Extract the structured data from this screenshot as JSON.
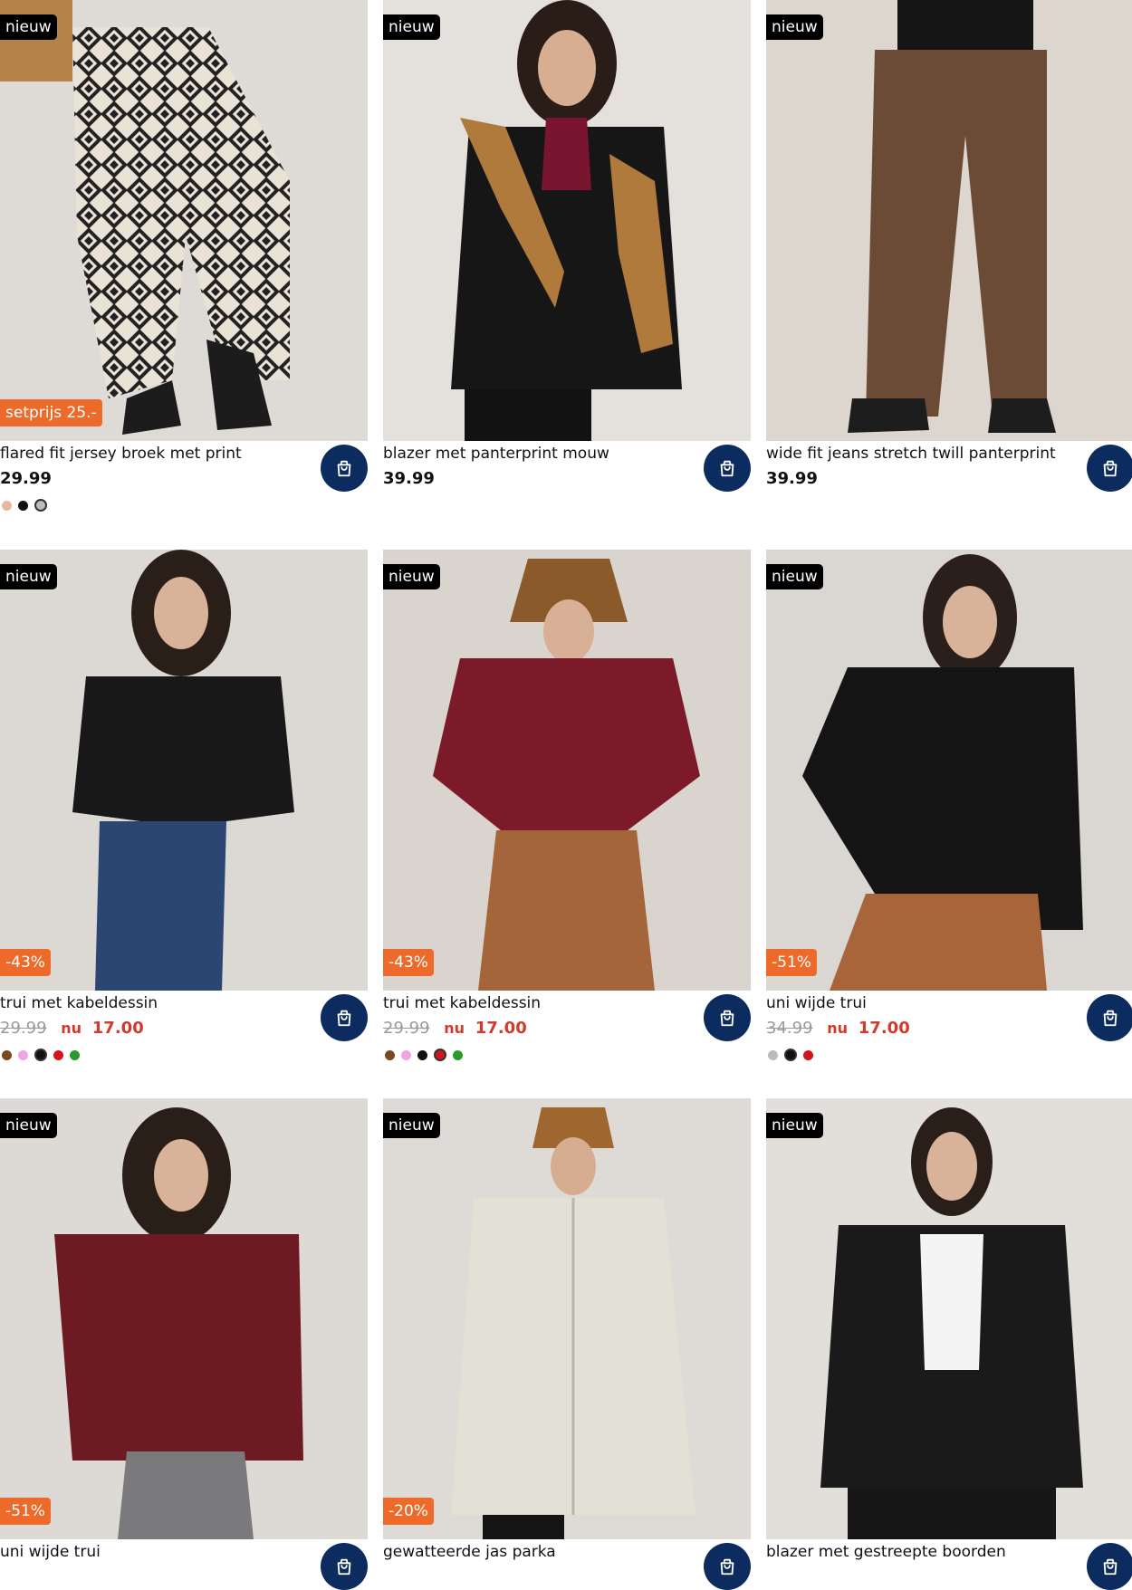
{
  "products": [
    {
      "badge": "nieuw",
      "promo": "setprijs 25.-",
      "title": "flared fit jersey broek met print",
      "price": "29.99",
      "old_price": "",
      "now_label": "",
      "new_price": "",
      "swatches": [
        "#e8b7a2",
        "#111111",
        "#bbbbbb"
      ],
      "selected_swatch": 2
    },
    {
      "badge": "nieuw",
      "promo": "",
      "title": "blazer met panterprint mouw",
      "price": "39.99",
      "old_price": "",
      "now_label": "",
      "new_price": "",
      "swatches": [],
      "selected_swatch": -1
    },
    {
      "badge": "nieuw",
      "promo": "",
      "title": "wide fit jeans stretch twill panterprint",
      "price": "39.99",
      "old_price": "",
      "now_label": "",
      "new_price": "",
      "swatches": [],
      "selected_swatch": -1
    },
    {
      "badge": "nieuw",
      "promo": "-43%",
      "title": "trui met kabeldessin",
      "price": "",
      "old_price": "29.99",
      "now_label": "nu",
      "new_price": "17.00",
      "swatches": [
        "#7a4a1e",
        "#f0a5e0",
        "#111111",
        "#d4141a",
        "#2a9a2a"
      ],
      "selected_swatch": 2
    },
    {
      "badge": "nieuw",
      "promo": "-43%",
      "title": "trui met kabeldessin",
      "price": "",
      "old_price": "29.99",
      "now_label": "nu",
      "new_price": "17.00",
      "swatches": [
        "#7a4a1e",
        "#f0a5e0",
        "#111111",
        "#d4141a",
        "#2a9a2a"
      ],
      "selected_swatch": 3
    },
    {
      "badge": "nieuw",
      "promo": "-51%",
      "title": "uni wijde trui",
      "price": "",
      "old_price": "34.99",
      "now_label": "nu",
      "new_price": "17.00",
      "swatches": [
        "#bbbbbb",
        "#111111",
        "#d4141a"
      ],
      "selected_swatch": 1
    },
    {
      "badge": "nieuw",
      "promo": "-51%",
      "title": "uni wijde trui",
      "price": "",
      "old_price": "",
      "now_label": "",
      "new_price": "",
      "swatches": [],
      "selected_swatch": -1
    },
    {
      "badge": "nieuw",
      "promo": "-20%",
      "title": "gewatteerde jas parka",
      "price": "",
      "old_price": "",
      "now_label": "",
      "new_price": "",
      "swatches": [],
      "selected_swatch": -1
    },
    {
      "badge": "nieuw",
      "promo": "",
      "title": "blazer met gestreepte boorden",
      "price": "",
      "old_price": "",
      "now_label": "",
      "new_price": "",
      "swatches": [],
      "selected_swatch": -1
    }
  ],
  "colors": {
    "cart_button": "#0c2b5e",
    "promo_badge": "#ee6a2a",
    "sale_price": "#d23a2c",
    "new_badge": "#000000"
  },
  "icons": {
    "cart": "shopping-bag-icon"
  }
}
